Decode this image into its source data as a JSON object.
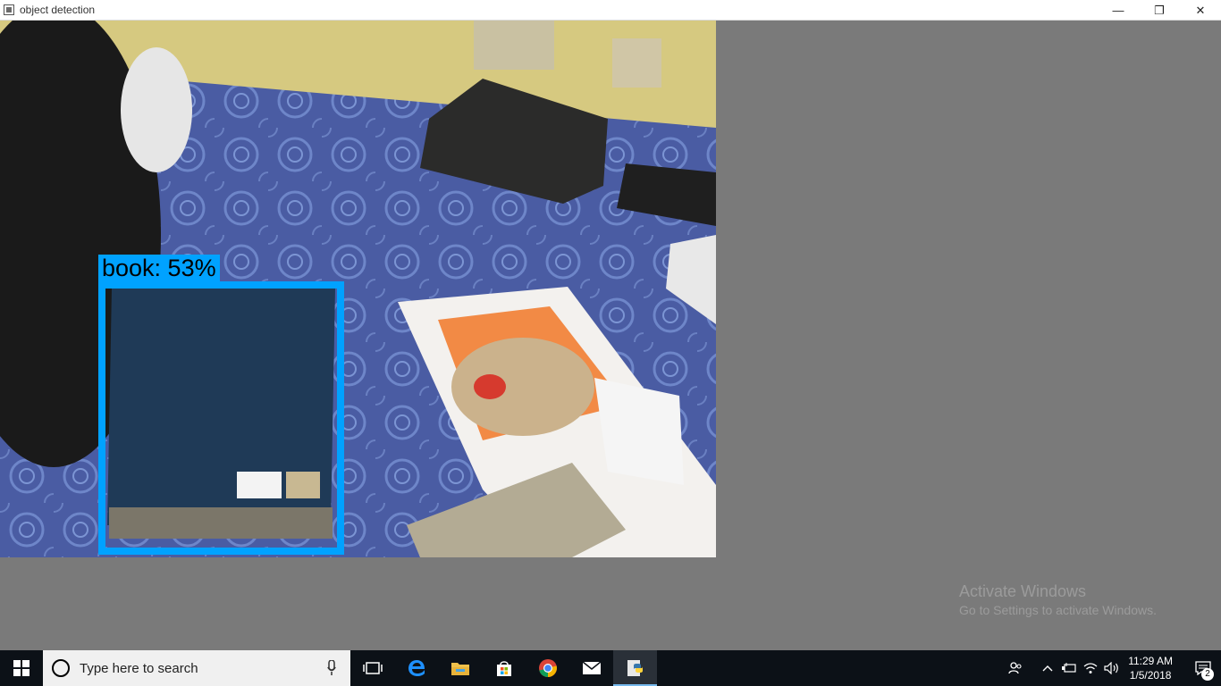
{
  "window": {
    "title": "object detection",
    "controls": {
      "minimize": "—",
      "restore": "❐",
      "close": "✕"
    }
  },
  "detection": {
    "label": "book: 53%",
    "box_color": "#00a2ff"
  },
  "watermark": {
    "title": "Activate Windows",
    "subtitle": "Go to Settings to activate Windows."
  },
  "taskbar": {
    "search_placeholder": "Type here to search",
    "apps": [
      {
        "name": "task-view-icon"
      },
      {
        "name": "edge-icon"
      },
      {
        "name": "file-explorer-icon"
      },
      {
        "name": "store-icon"
      },
      {
        "name": "chrome-icon"
      },
      {
        "name": "mail-icon"
      },
      {
        "name": "python-icon",
        "active": true
      }
    ],
    "clock": {
      "time": "11:29 AM",
      "date": "1/5/2018"
    },
    "notifications": "2"
  }
}
